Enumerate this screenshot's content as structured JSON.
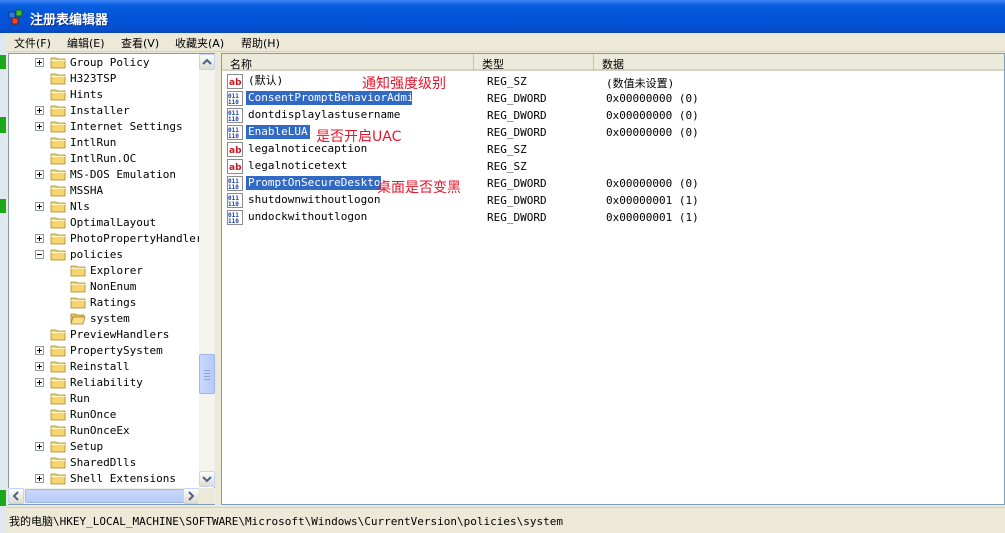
{
  "window": {
    "title": "注册表编辑器"
  },
  "menu": [
    "文件(F)",
    "编辑(E)",
    "查看(V)",
    "收藏夹(A)",
    "帮助(H)"
  ],
  "tree": [
    {
      "label": "Group Policy",
      "expander": "plus",
      "indent": 0
    },
    {
      "label": "H323TSP",
      "expander": "none",
      "indent": 0
    },
    {
      "label": "Hints",
      "expander": "none",
      "indent": 0
    },
    {
      "label": "Installer",
      "expander": "plus",
      "indent": 0
    },
    {
      "label": "Internet Settings",
      "expander": "plus",
      "indent": 0
    },
    {
      "label": "IntlRun",
      "expander": "none",
      "indent": 0
    },
    {
      "label": "IntlRun.OC",
      "expander": "none",
      "indent": 0
    },
    {
      "label": "MS-DOS Emulation",
      "expander": "plus",
      "indent": 0
    },
    {
      "label": "MSSHA",
      "expander": "none",
      "indent": 0
    },
    {
      "label": "Nls",
      "expander": "plus",
      "indent": 0
    },
    {
      "label": "OptimalLayout",
      "expander": "none",
      "indent": 0
    },
    {
      "label": "PhotoPropertyHandler",
      "expander": "plus",
      "indent": 0
    },
    {
      "label": "policies",
      "expander": "minus",
      "indent": 0
    },
    {
      "label": "Explorer",
      "expander": "none",
      "indent": 1
    },
    {
      "label": "NonEnum",
      "expander": "none",
      "indent": 1
    },
    {
      "label": "Ratings",
      "expander": "none",
      "indent": 1
    },
    {
      "label": "system",
      "expander": "none",
      "indent": 1,
      "open": true
    },
    {
      "label": "PreviewHandlers",
      "expander": "none",
      "indent": 0
    },
    {
      "label": "PropertySystem",
      "expander": "plus",
      "indent": 0
    },
    {
      "label": "Reinstall",
      "expander": "plus",
      "indent": 0
    },
    {
      "label": "Reliability",
      "expander": "plus",
      "indent": 0
    },
    {
      "label": "Run",
      "expander": "none",
      "indent": 0
    },
    {
      "label": "RunOnce",
      "expander": "none",
      "indent": 0
    },
    {
      "label": "RunOnceEx",
      "expander": "none",
      "indent": 0
    },
    {
      "label": "Setup",
      "expander": "plus",
      "indent": 0
    },
    {
      "label": "SharedDlls",
      "expander": "none",
      "indent": 0
    },
    {
      "label": "Shell Extensions",
      "expander": "plus",
      "indent": 0
    }
  ],
  "columns": [
    "名称",
    "类型",
    "数据"
  ],
  "values": [
    {
      "icon": "string-value-icon",
      "name": "(默认)",
      "type": "REG_SZ",
      "data": "(数值未设置)",
      "selected": false
    },
    {
      "icon": "dword-value-icon",
      "name": "ConsentPromptBehaviorAdmin",
      "type": "REG_DWORD",
      "data": "0x00000000 (0)",
      "selected": true
    },
    {
      "icon": "dword-value-icon",
      "name": "dontdisplaylastusername",
      "type": "REG_DWORD",
      "data": "0x00000000 (0)",
      "selected": false
    },
    {
      "icon": "dword-value-icon",
      "name": "EnableLUA",
      "type": "REG_DWORD",
      "data": "0x00000000 (0)",
      "selected": true
    },
    {
      "icon": "string-value-icon",
      "name": "legalnoticecaption",
      "type": "REG_SZ",
      "data": "",
      "selected": false
    },
    {
      "icon": "string-value-icon",
      "name": "legalnoticetext",
      "type": "REG_SZ",
      "data": "",
      "selected": false
    },
    {
      "icon": "dword-value-icon",
      "name": "PromptOnSecureDesktop",
      "type": "REG_DWORD",
      "data": "0x00000000 (0)",
      "selected": true
    },
    {
      "icon": "dword-value-icon",
      "name": "shutdownwithoutlogon",
      "type": "REG_DWORD",
      "data": "0x00000001 (1)",
      "selected": false
    },
    {
      "icon": "dword-value-icon",
      "name": "undockwithoutlogon",
      "type": "REG_DWORD",
      "data": "0x00000001 (1)",
      "selected": false
    }
  ],
  "annotations": {
    "consent": "通知强度级别",
    "enablelua": "是否开启UAC",
    "secure_desktop": "桌面是否变黑"
  },
  "status": "我的电脑\\HKEY_LOCAL_MACHINE\\SOFTWARE\\Microsoft\\Windows\\CurrentVersion\\policies\\system",
  "colors": {
    "titlebar": "#0453d8",
    "selection": "#316ac5",
    "annotation": "#e8152d",
    "folder": "#f5d66e"
  }
}
